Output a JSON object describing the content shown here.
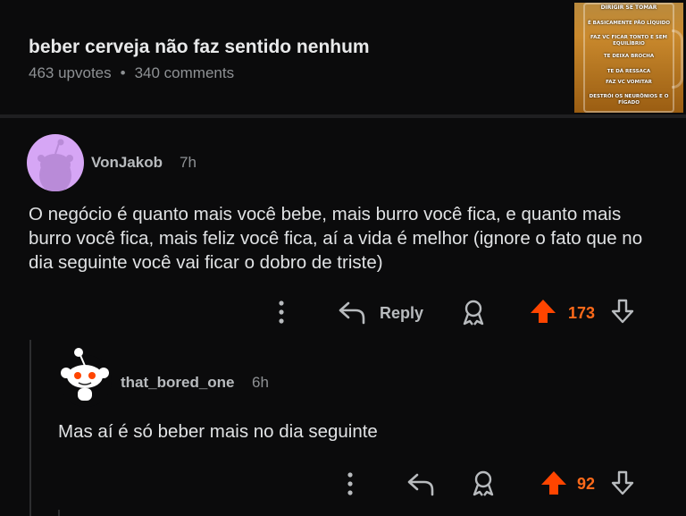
{
  "post": {
    "title": "beber cerveja não faz sentido nenhum",
    "upvotes": "463 upvotes",
    "separator": "•",
    "comments": "340 comments",
    "thumbnail": {
      "lines": [
        "DIRIGIR SE TOMAR",
        "É BASICAMENTE PÃO LÍQUIDO",
        "FAZ VC FICAR TONTO E SEM EQUILÍBRIO",
        "TE DEIXA BROCHA",
        "TE DÁ RESSACA",
        "FAZ VC VOMITAR",
        "DESTRÓI OS NEURÔNIOS E O FÍGADO"
      ]
    }
  },
  "comment1": {
    "username": "VonJakob",
    "time": "7h",
    "body": "O negócio é quanto mais você bebe, mais burro você fica, e quanto mais burro você fica, mais feliz você fica, aí a vida é melhor (ignore o fato que no dia seguinte você vai ficar o dobro de triste)",
    "reply_label": "Reply",
    "score": "173",
    "avatar_color": "#d6a6f5"
  },
  "comment2": {
    "username": "that_bored_one",
    "time": "6h",
    "body": "Mas aí é só beber mais no dia seguinte",
    "score": "92"
  },
  "colors": {
    "background": "#0b0b0c",
    "upvote": "#ff4500",
    "score": "#ff6a1a",
    "muted": "#8e9194"
  }
}
